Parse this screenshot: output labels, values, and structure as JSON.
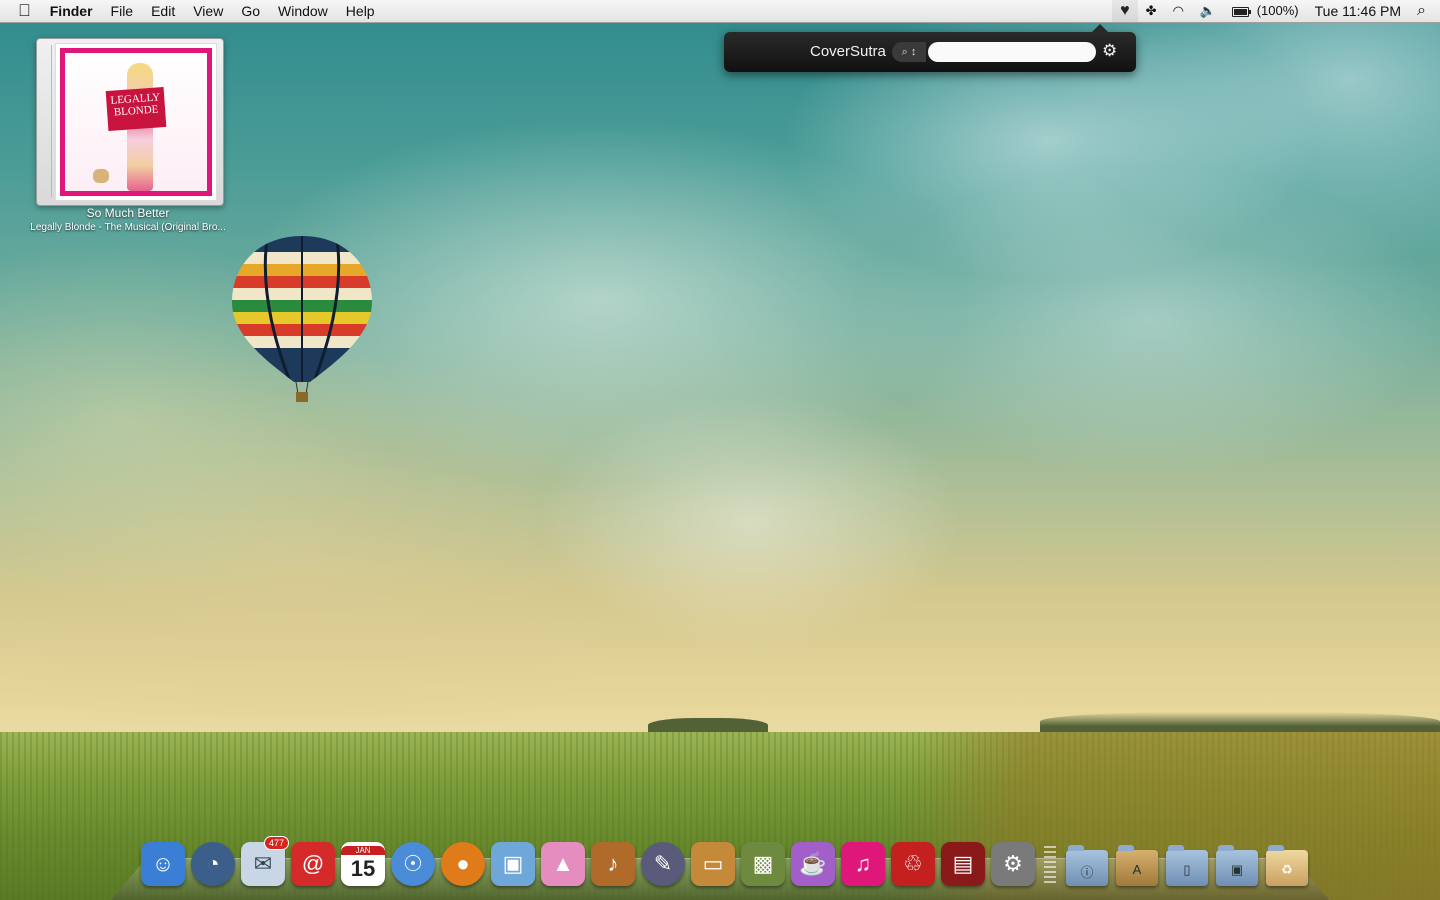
{
  "menubar": {
    "apple_glyph": "",
    "app_name": "Finder",
    "menus": [
      "File",
      "Edit",
      "View",
      "Go",
      "Window",
      "Help"
    ],
    "status": {
      "heart_glyph": "♥",
      "sync_glyph": "✤",
      "wifi_glyph": "◠",
      "volume_glyph": "🔈",
      "battery_percent": "(100%)",
      "clock": "Tue 11:46 PM",
      "spotlight_glyph": "⌕"
    }
  },
  "coversutra": {
    "title": "CoverSutra",
    "search_scope_label": "⌕ ↕",
    "search_value": "",
    "gear_glyph": "⚙"
  },
  "now_playing": {
    "cover_title": "LEGALLY BLONDE",
    "track": "So Much Better",
    "album": "Legally Blonde - The Musical (Original Bro..."
  },
  "dock": {
    "apps": [
      {
        "name": "finder",
        "glyph": "☺",
        "color": "#3a7fd5"
      },
      {
        "name": "dashboard",
        "glyph": "◔",
        "color": "#3b5f8a",
        "round": true
      },
      {
        "name": "mail",
        "glyph": "✉",
        "color": "#c9d6e6",
        "badge": "477"
      },
      {
        "name": "address-book",
        "glyph": "@",
        "color": "#d52a2a"
      },
      {
        "name": "calendar",
        "month": "JAN",
        "day": "15"
      },
      {
        "name": "safari",
        "glyph": "☉",
        "color": "#4a8cd8",
        "round": true
      },
      {
        "name": "firefox",
        "glyph": "●",
        "color": "#e07b1a",
        "round": true
      },
      {
        "name": "preview",
        "glyph": "▣",
        "color": "#6fa7d9"
      },
      {
        "name": "ghost",
        "glyph": "▲",
        "color": "#e68dbf"
      },
      {
        "name": "garageband",
        "glyph": "♪",
        "color": "#b06a2a"
      },
      {
        "name": "inkscape",
        "glyph": "✎",
        "color": "#5a5a7a",
        "round": true
      },
      {
        "name": "keynote",
        "glyph": "▭",
        "color": "#c48a3a"
      },
      {
        "name": "iphoto",
        "glyph": "▩",
        "color": "#6d8a3e"
      },
      {
        "name": "slushie",
        "glyph": "☕",
        "color": "#a25fc9"
      },
      {
        "name": "itunes-cover",
        "glyph": "♫",
        "color": "#e0177a"
      },
      {
        "name": "front-row",
        "glyph": "♲",
        "color": "#c42020"
      },
      {
        "name": "photo-booth",
        "glyph": "▤",
        "color": "#8a1a1a"
      },
      {
        "name": "system-preferences",
        "glyph": "⚙",
        "color": "#7a7a7a"
      }
    ],
    "folders": [
      {
        "name": "applications-folder",
        "glyph": "ⓘ"
      },
      {
        "name": "mail-downloads-folder",
        "glyph": "A"
      },
      {
        "name": "documents-folder",
        "glyph": "▯"
      },
      {
        "name": "pictures-folder",
        "glyph": "▣"
      },
      {
        "name": "trash",
        "glyph": "♻"
      }
    ]
  }
}
